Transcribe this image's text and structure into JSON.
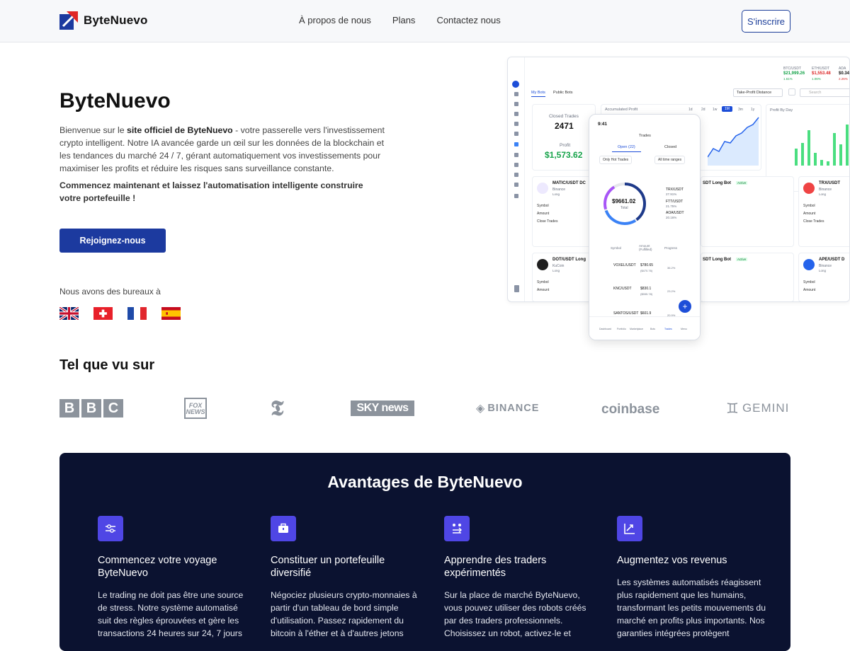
{
  "header": {
    "brand": "ByteNuevo",
    "nav": [
      "À propos de nous",
      "Plans",
      "Contactez nous"
    ],
    "signup": "S'inscrire"
  },
  "hero": {
    "title": "ByteNuevo",
    "p1_a": "Bienvenue sur le ",
    "p1_bold": "site officiel de ByteNuevo",
    "p1_b": " - votre passerelle vers l'investissement crypto intelligent. Notre IA avancée garde un œil sur les données de la blockchain et les tendances du marché 24 / 7, gérant automatiquement vos investissements pour maximiser les profits et réduire les risques sans surveillance constante.",
    "p2": "Commencez maintenant et laissez l'automatisation intelligente construire votre portefeuille !",
    "cta": "Rejoignez-nous",
    "offices": "Nous avons des bureaux à",
    "flags": [
      "uk-flag",
      "switzerland-flag",
      "france-flag",
      "spain-flag"
    ]
  },
  "dashboard": {
    "tickers": [
      {
        "pair": "BTC/USDT",
        "price": "$21,999.26",
        "change": "1.61%"
      },
      {
        "pair": "ETH/USDT",
        "price": "$1,553.48",
        "change": "1.06%"
      },
      {
        "pair": "ADA",
        "price": "$0.34",
        "change": "2.26%"
      }
    ],
    "tabs": [
      "My Bots",
      "Public Bots"
    ],
    "sort": "Take-Profit Distance",
    "search": "Search",
    "closed_trades_label": "Closed Trades",
    "closed_trades": "2471",
    "profit_label": "Profit",
    "profit": "$1,573.62",
    "accum_label": "Accumulated Profit",
    "ranges": [
      "1d",
      "2d",
      "1w",
      "1M",
      "3m",
      "1y"
    ],
    "profit_by_day": "Profit By Day",
    "bot1": {
      "name": "MATIC/USDT DC",
      "exchange": "Binance",
      "side": "Long"
    },
    "bot2": {
      "name": "DOT/USDT Long",
      "exchange": "KuCoin",
      "side": "Long"
    },
    "bot3": {
      "name": "TRX/USDT",
      "exchange": "Binance",
      "side": "Long"
    },
    "bot4": {
      "name": "APE/USDT D",
      "exchange": "Binance",
      "side": "Long"
    },
    "bot_mid1": "SDT Long Bot",
    "bot_mid2": "SDT Long Bot",
    "active": "Active",
    "row_labels": [
      "Symbol",
      "Amount",
      "Close Trades"
    ],
    "phone": {
      "time": "9:41",
      "title": "Trades",
      "tab_open": "Open (22)",
      "tab_closed": "Closed",
      "filter1": "Only Hot Trades",
      "filter2": "All time ranges",
      "total": "$9661.02",
      "total_label": "Total",
      "legend": [
        {
          "name": "TRX/USDT",
          "pct": "27.91%"
        },
        {
          "name": "FTT/USDT",
          "pct": "21.75%"
        },
        {
          "name": "AOA/USDT",
          "pct": "20.16%"
        }
      ],
      "cols": [
        "Symbol",
        "Amount (Fulfilled)",
        "Progress"
      ],
      "rows": [
        {
          "sym": "VOXEL/USDT",
          "amt": "$780.65",
          "sub": "($470.76)",
          "pct": "36.2%"
        },
        {
          "sym": "KNC/USDT",
          "amt": "$830.1",
          "sub": "($555.78)",
          "pct": "23.2%"
        },
        {
          "sym": "SANTOS/USDT",
          "amt": "$601.9",
          "sub": "",
          "pct": "20.9%"
        }
      ],
      "bottom": [
        "Dashboard",
        "Portfolio",
        "Marketplace",
        "Bots",
        "Trades",
        "Menu"
      ]
    }
  },
  "seen": {
    "title": "Tel que vu sur",
    "brands": [
      "BBC",
      "FOX NEWS",
      "T",
      "SKY NEWS",
      "BINANCE",
      "coinbase",
      "GEMINI"
    ]
  },
  "benefits": {
    "title": "Avantages de ByteNuevo",
    "cols": [
      {
        "icon": "sliders-icon",
        "title": "Commencez votre voyage ByteNuevo",
        "text": "Le trading ne doit pas être une source de stress. Notre système automatisé suit des règles éprouvées et gère les transactions 24 heures sur 24, 7 jours"
      },
      {
        "icon": "briefcase-icon",
        "title": "Constituer un portefeuille diversifié",
        "text": "Négociez plusieurs crypto-monnaies à partir d'un tableau de bord simple d'utilisation. Passez rapidement du bitcoin à l'éther et à d'autres jetons"
      },
      {
        "icon": "people-exchange-icon",
        "title": "Apprendre des traders expérimentés",
        "text": "Sur la place de marché ByteNuevo, vous pouvez utiliser des robots créés par des traders professionnels. Choisissez un robot, activez-le et"
      },
      {
        "icon": "chart-arrow-icon",
        "title": "Augmentez vos revenus",
        "text": "Les systèmes automatisés réagissent plus rapidement que les humains, transformant les petits mouvements du marché en profits plus importants. Nos garanties intégrées protègent"
      }
    ]
  }
}
